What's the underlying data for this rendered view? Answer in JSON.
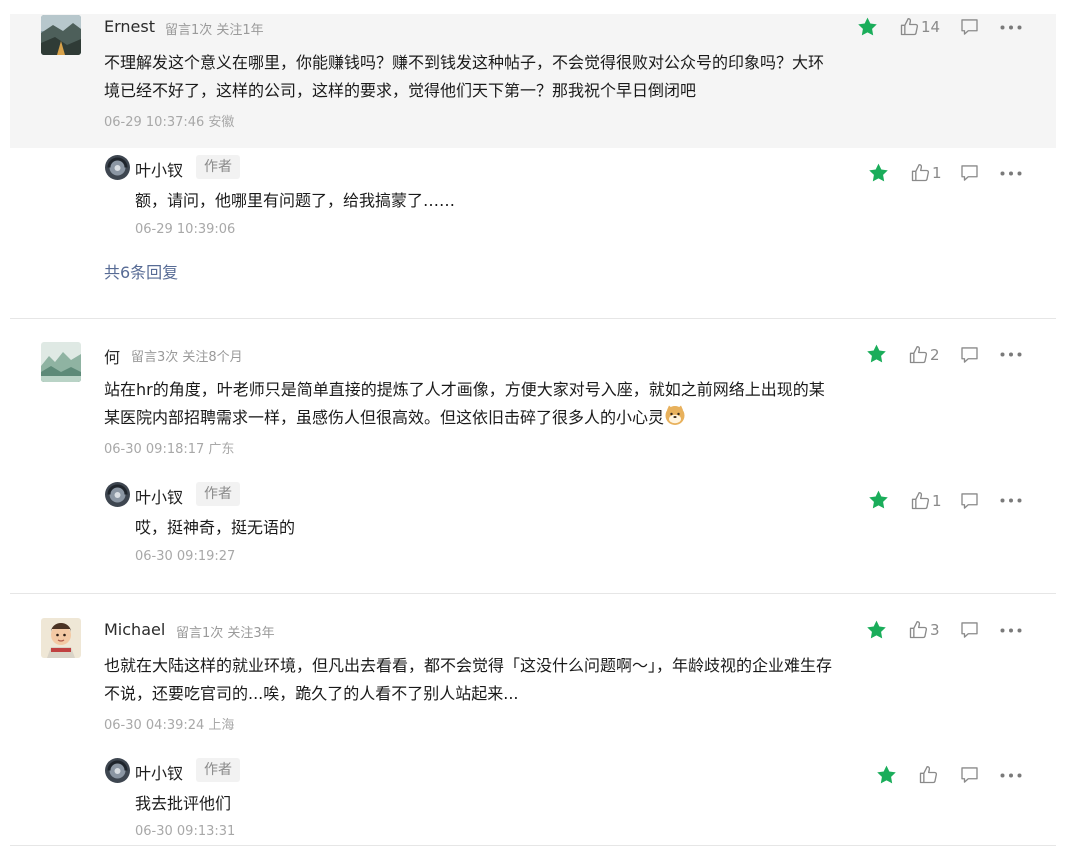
{
  "colors": {
    "star": "#1aad5a",
    "link": "#576b95",
    "icon": "#8a8a8a",
    "highlight_bg": "#f5f5f5"
  },
  "icons": {
    "star": "star-icon",
    "like": "thumbs-up-icon",
    "reply": "comment-bubble-icon",
    "more": "more-dots-icon",
    "emoji": "doge-emoji-icon"
  },
  "comments": [
    {
      "name": "Ernest",
      "meta": "留言1次 关注1年",
      "text": "不理解发这个意义在哪里，你能赚钱吗？赚不到钱发这种帖子，不会觉得很败对公众号的印象吗？大环境已经不好了，这样的公司，这样的要求，觉得他们天下第一？那我祝个早日倒闭吧",
      "time": "06-29 10:37:46 安徽",
      "likes": "14",
      "reply": {
        "name": "叶小钗",
        "tag": "作者",
        "text": "额，请问，他哪里有问题了，给我搞蒙了……",
        "time": "06-29 10:39:06",
        "likes": "1"
      },
      "more_replies": "共6条回复"
    },
    {
      "name": "何",
      "meta": "留言3次 关注8个月",
      "text": "站在hr的角度，叶老师只是简单直接的提炼了人才画像，方便大家对号入座，就如之前网络上出现的某某医院内部招聘需求一样，虽感伤人但很高效。但这依旧击碎了很多人的小心灵",
      "time": "06-30 09:18:17 广东",
      "likes": "2",
      "reply": {
        "name": "叶小钗",
        "tag": "作者",
        "text": "哎，挺神奇，挺无语的",
        "time": "06-30 09:19:27",
        "likes": "1"
      }
    },
    {
      "name": "Michael",
      "meta": "留言1次 关注3年",
      "text": "也就在大陆这样的就业环境，但凡出去看看，都不会觉得「这没什么问题啊～」，年龄歧视的企业难生存不说，还要吃官司的...唉，跪久了的人看不了别人站起来...",
      "time": "06-30 04:39:24 上海",
      "likes": "3",
      "reply": {
        "name": "叶小钗",
        "tag": "作者",
        "text": "我去批评他们",
        "time": "06-30 09:13:31",
        "likes": ""
      }
    }
  ]
}
